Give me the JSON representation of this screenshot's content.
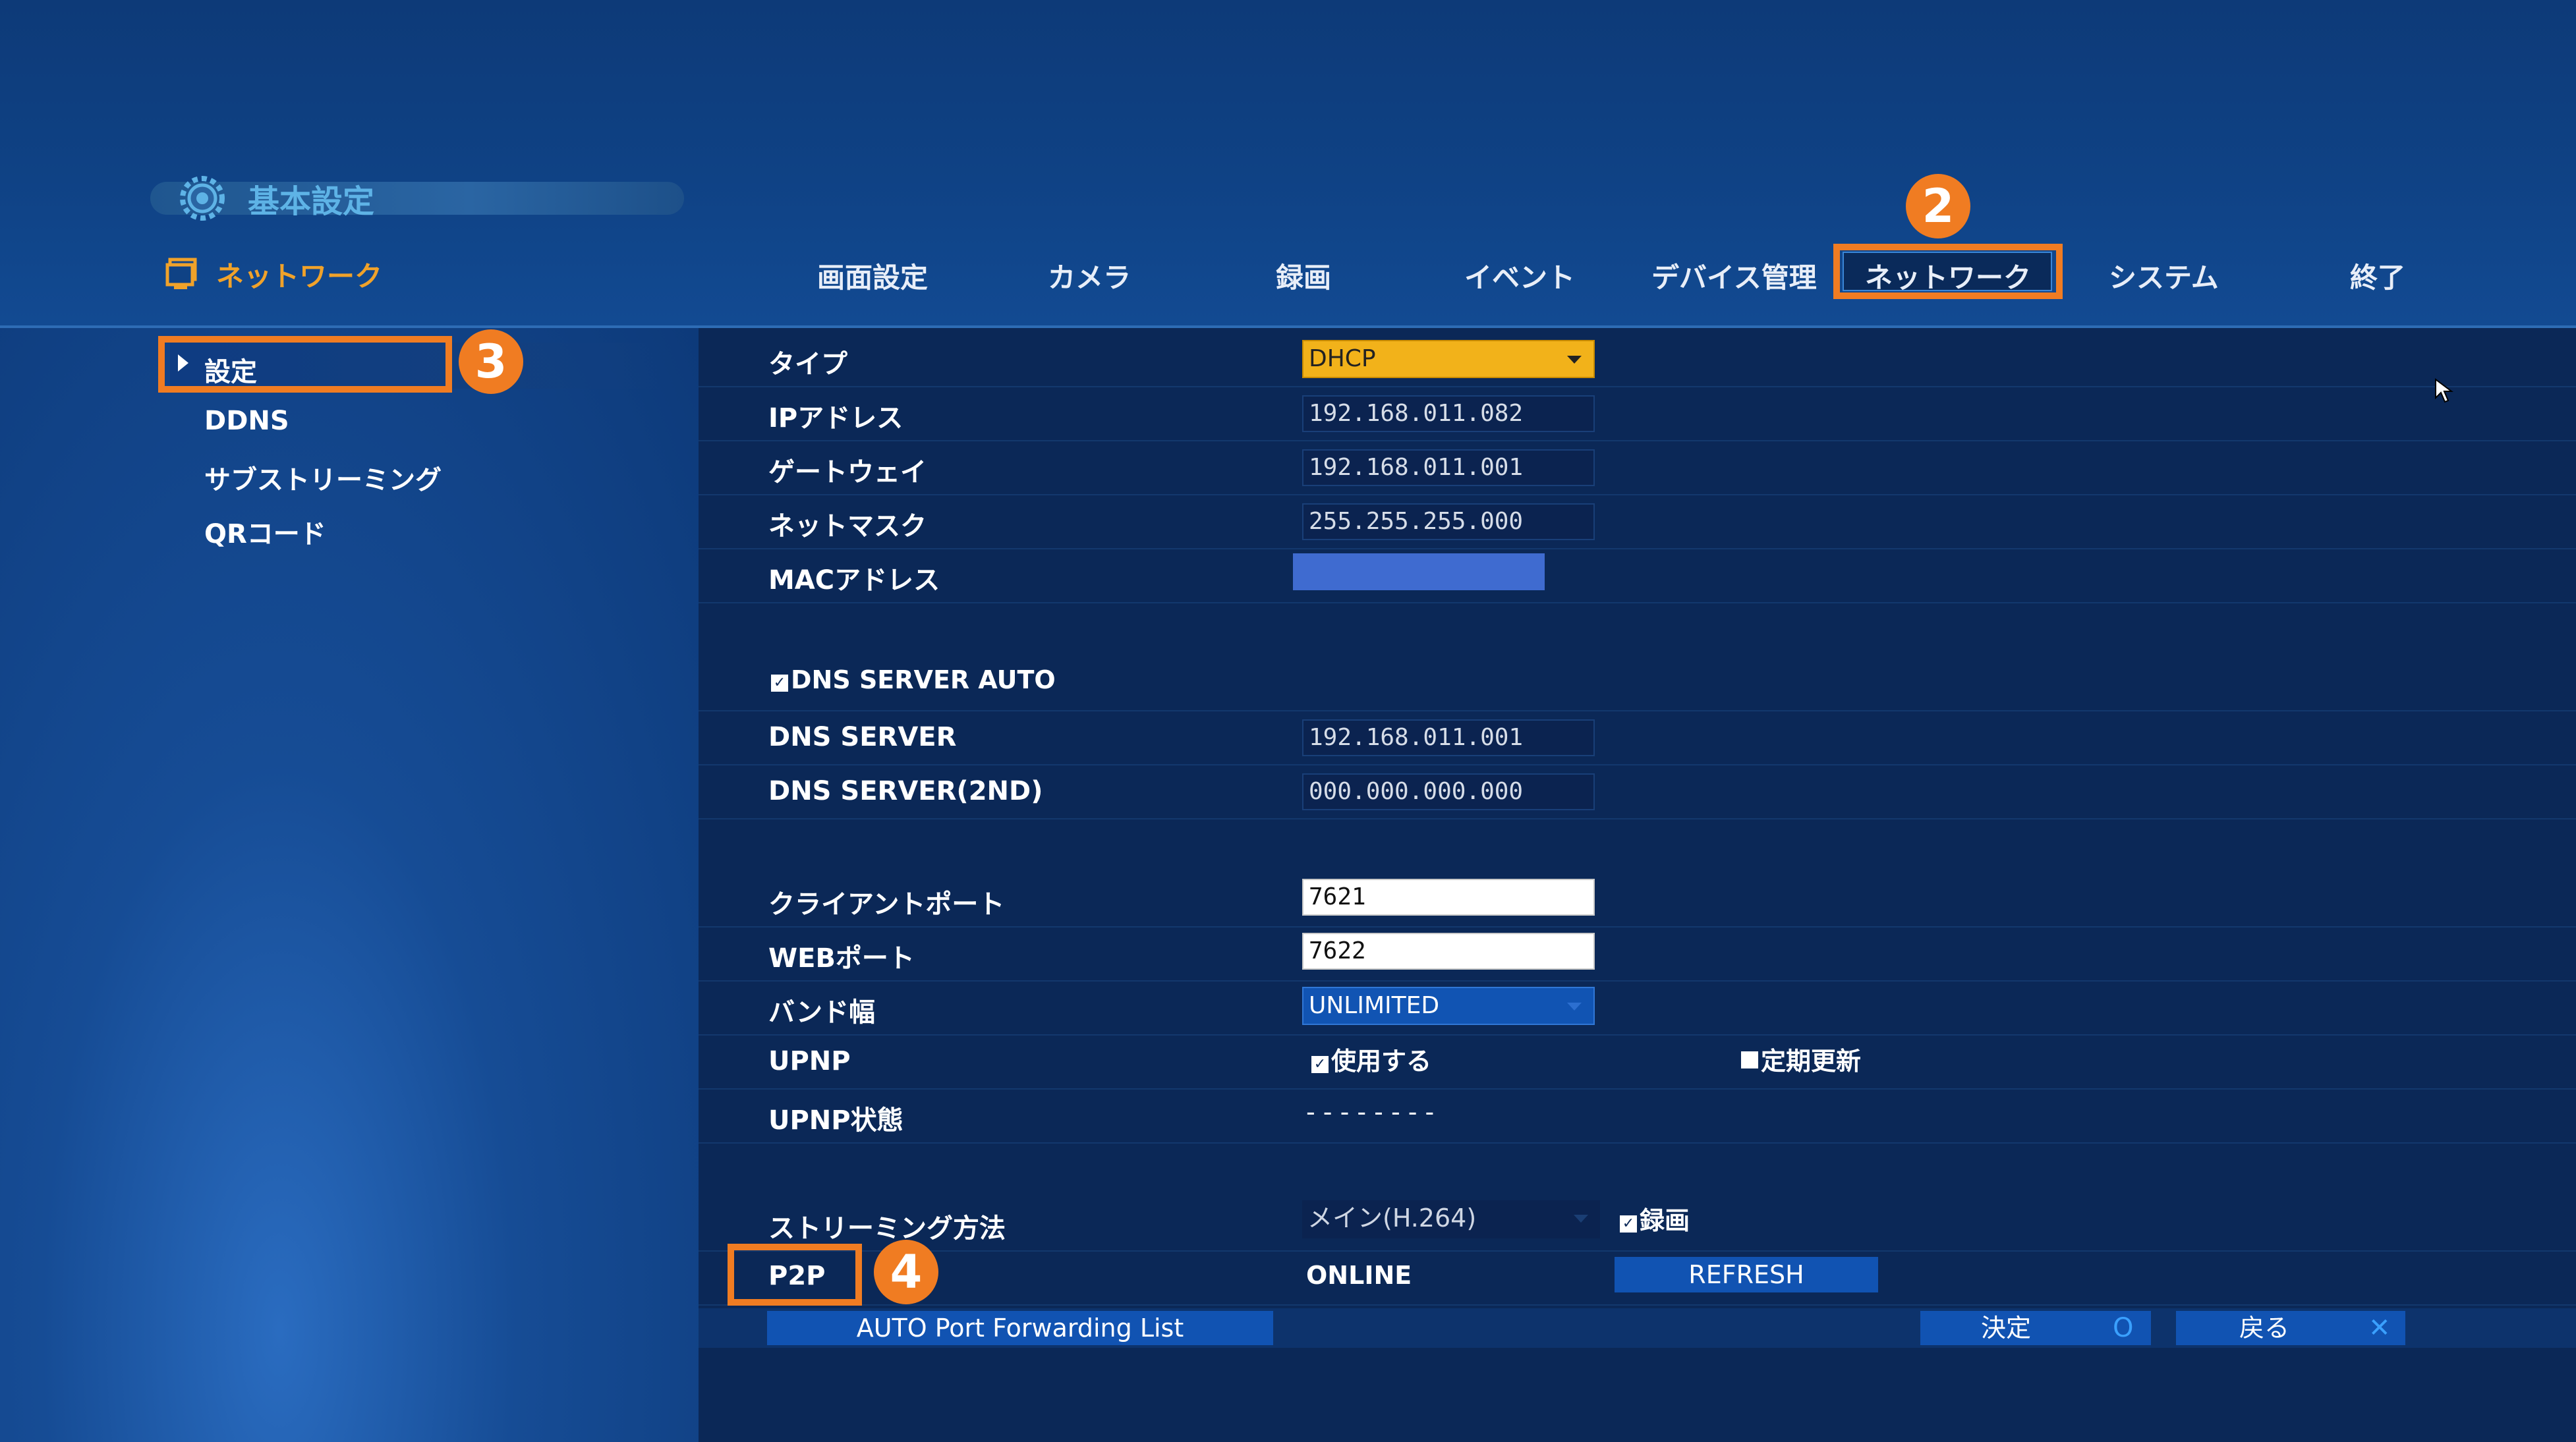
{
  "header": {
    "title": "基本設定",
    "section": "ネットワーク",
    "tabs": [
      "画面設定",
      "カメラ",
      "録画",
      "イベント",
      "デバイス管理",
      "ネットワーク",
      "システム",
      "終了"
    ],
    "active_tab": "ネットワーク"
  },
  "annotations": {
    "badge_tab": "2",
    "badge_sidebar": "3",
    "badge_p2p": "4",
    "color": "#f07c22"
  },
  "sidebar": {
    "items": [
      "設定",
      "DDNS",
      "サブストリーミング",
      "QRコード"
    ],
    "selected": "設定"
  },
  "form": {
    "type_label": "タイプ",
    "type_value": "DHCP",
    "ip_label": "IPアドレス",
    "ip_value": "192.168.011.082",
    "gateway_label": "ゲートウェイ",
    "gateway_value": "192.168.011.001",
    "netmask_label": "ネットマスク",
    "netmask_value": "255.255.255.000",
    "mac_label": "MACアドレス",
    "dns_auto_label": "DNS SERVER AUTO",
    "dns_label": "DNS SERVER",
    "dns_value": "192.168.011.001",
    "dns2_label": "DNS SERVER(2ND)",
    "dns2_value": "000.000.000.000",
    "client_port_label": "クライアントポート",
    "client_port_value": "7621",
    "web_port_label": "WEBポート",
    "web_port_value": "7622",
    "bandwidth_label": "バンド幅",
    "bandwidth_value": "UNLIMITED",
    "upnp_label": "UPNP",
    "upnp_use_label": "使用する",
    "upnp_refresh_label": "定期更新",
    "upnp_status_label": "UPNP状態",
    "upnp_status_value": "- - - - - - - -",
    "streaming_label": "ストリーミング方法",
    "streaming_value": "メイン(H.264)",
    "record_label": "録画",
    "p2p_label": "P2P",
    "p2p_value": "ONLINE",
    "refresh_button": "REFRESH"
  },
  "footer": {
    "port_list_button": "AUTO Port Forwarding List",
    "ok_button": "決定",
    "ok_icon": "O",
    "back_button": "戻る",
    "back_icon": "✕"
  },
  "colors": {
    "accent_orange": "#f07c22",
    "select_yellow": "#f2b21a",
    "button_blue": "#1153b2",
    "mac_blue": "#3f6bd0"
  }
}
